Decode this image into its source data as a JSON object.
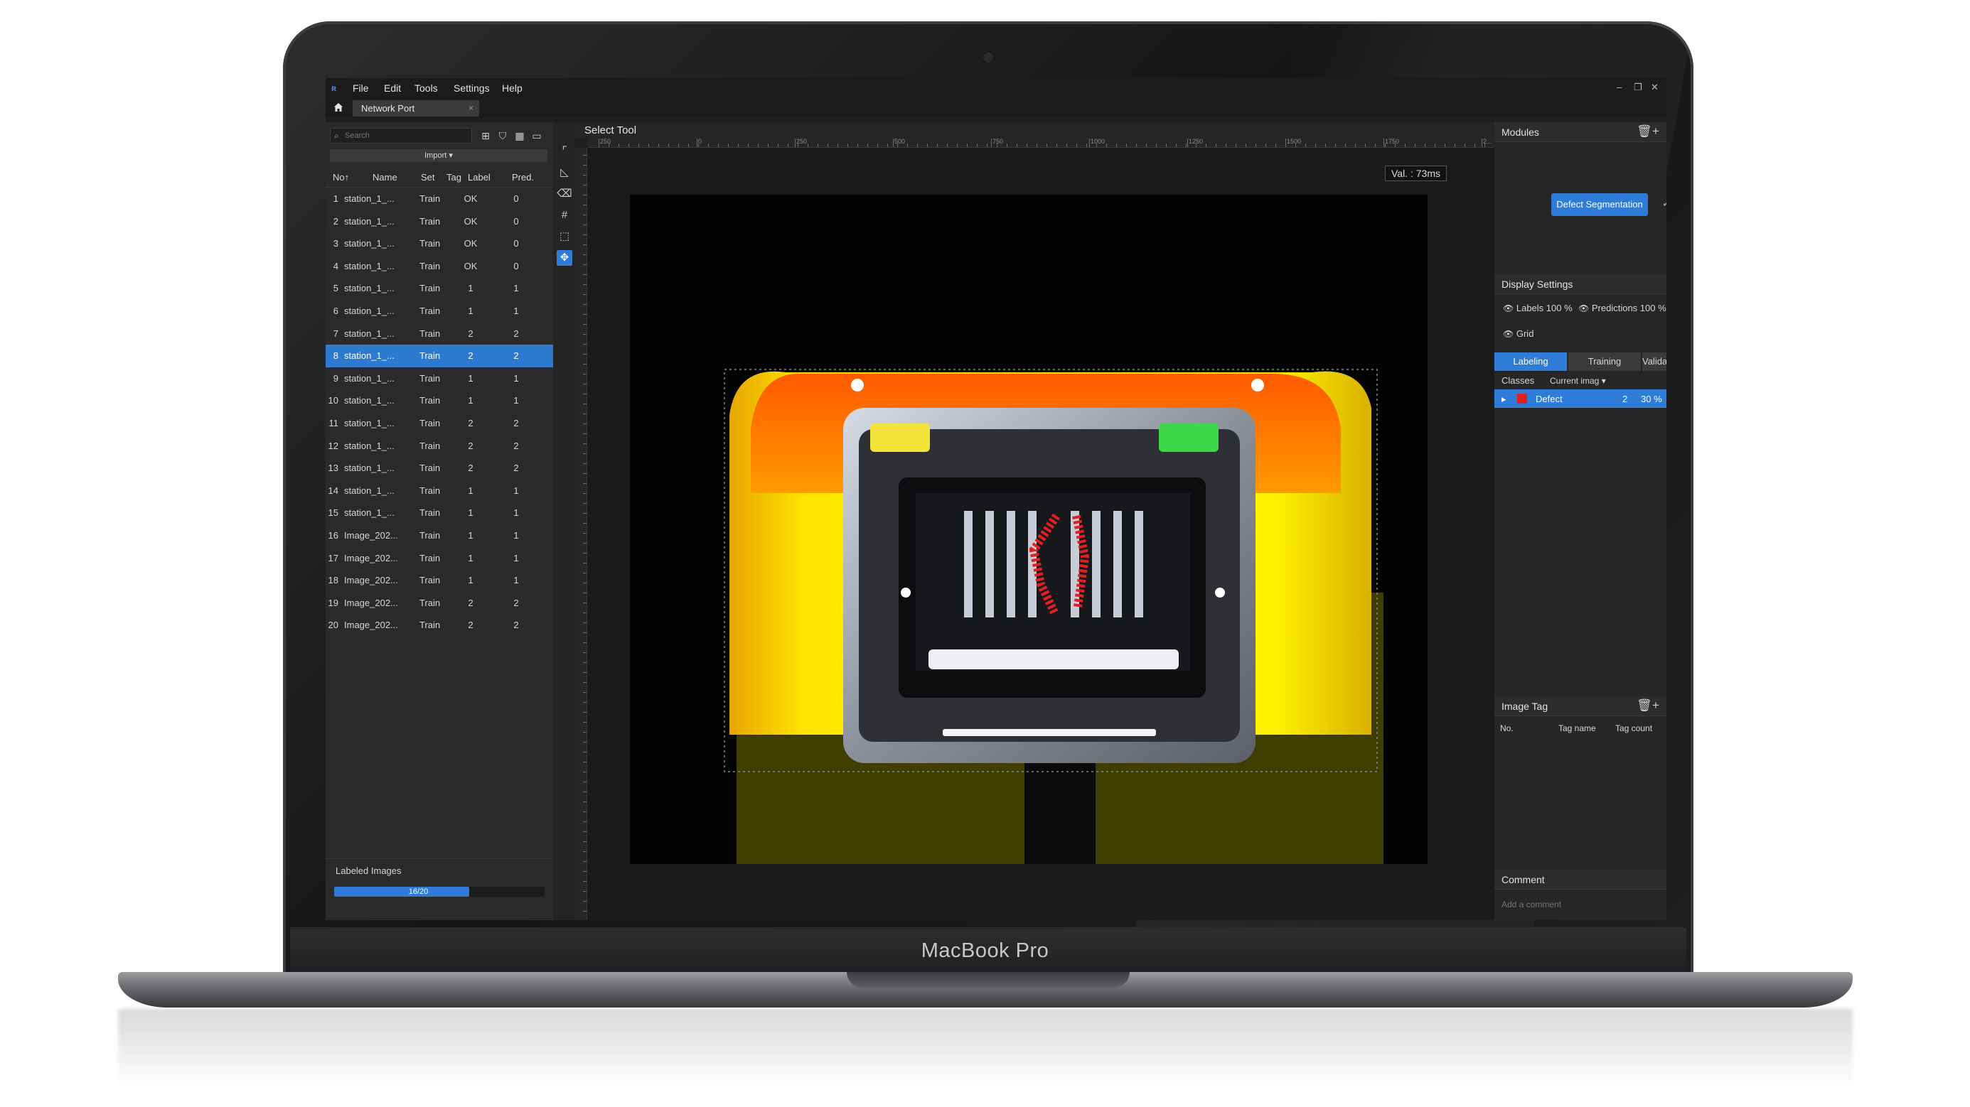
{
  "device": {
    "brand_label": "MacBook Pro"
  },
  "app": {
    "menu": [
      "File",
      "Edit",
      "Tools",
      "Settings",
      "Help"
    ],
    "window_controls": [
      "–",
      "❐",
      "✕"
    ],
    "project_tab": {
      "label": "Network Port",
      "close": "×"
    }
  },
  "left_panel": {
    "search": {
      "placeholder": "Search"
    },
    "import_label": "Import ▾",
    "columns": {
      "no": "No↑",
      "name": "Name",
      "set": "Set",
      "tag": "Tag",
      "label": "Label",
      "pred": "Pred."
    },
    "rows": [
      {
        "no": "1",
        "name": "station_1_...",
        "set": "Train",
        "label": "OK",
        "pred": "0"
      },
      {
        "no": "2",
        "name": "station_1_...",
        "set": "Train",
        "label": "OK",
        "pred": "0"
      },
      {
        "no": "3",
        "name": "station_1_...",
        "set": "Train",
        "label": "OK",
        "pred": "0"
      },
      {
        "no": "4",
        "name": "station_1_...",
        "set": "Train",
        "label": "OK",
        "pred": "0"
      },
      {
        "no": "5",
        "name": "station_1_...",
        "set": "Train",
        "label": "1",
        "pred": "1"
      },
      {
        "no": "6",
        "name": "station_1_...",
        "set": "Train",
        "label": "1",
        "pred": "1"
      },
      {
        "no": "7",
        "name": "station_1_...",
        "set": "Train",
        "label": "2",
        "pred": "2"
      },
      {
        "no": "8",
        "name": "station_1_...",
        "set": "Train",
        "label": "2",
        "pred": "2",
        "selected": true
      },
      {
        "no": "9",
        "name": "station_1_...",
        "set": "Train",
        "label": "1",
        "pred": "1"
      },
      {
        "no": "10",
        "name": "station_1_...",
        "set": "Train",
        "label": "1",
        "pred": "1"
      },
      {
        "no": "11",
        "name": "station_1_...",
        "set": "Train",
        "label": "2",
        "pred": "2"
      },
      {
        "no": "12",
        "name": "station_1_...",
        "set": "Train",
        "label": "2",
        "pred": "2"
      },
      {
        "no": "13",
        "name": "station_1_...",
        "set": "Train",
        "label": "2",
        "pred": "2"
      },
      {
        "no": "14",
        "name": "station_1_...",
        "set": "Train",
        "label": "1",
        "pred": "1"
      },
      {
        "no": "15",
        "name": "station_1_...",
        "set": "Train",
        "label": "1",
        "pred": "1"
      },
      {
        "no": "16",
        "name": "Image_202...",
        "set": "Train",
        "label": "1",
        "pred": "1"
      },
      {
        "no": "17",
        "name": "Image_202...",
        "set": "Train",
        "label": "1",
        "pred": "1"
      },
      {
        "no": "18",
        "name": "Image_202...",
        "set": "Train",
        "label": "1",
        "pred": "1"
      },
      {
        "no": "19",
        "name": "Image_202...",
        "set": "Train",
        "label": "2",
        "pred": "2"
      },
      {
        "no": "20",
        "name": "Image_202...",
        "set": "Train",
        "label": "2",
        "pred": "2"
      }
    ],
    "labeled_images": {
      "title": "Labeled Images",
      "progress_text": "16/20",
      "progress_fraction": 0.8
    }
  },
  "canvas": {
    "title": "Select Tool",
    "val_badge": "Val. : 73ms",
    "ruler_labels": [
      "250",
      "0",
      "250",
      "500",
      "750",
      "1000",
      "1250",
      "1500",
      "1750",
      "2..."
    ]
  },
  "right_panel": {
    "modules": {
      "title": "Modules",
      "node_label": "Defect Segmentation",
      "check": "✓"
    },
    "display_settings": {
      "title": "Display Settings",
      "labels": "Labels",
      "labels_pct": "100 %",
      "predictions": "Predictions",
      "predictions_pct": "100 %",
      "grid": "Grid"
    },
    "tabs": [
      "Labeling",
      "Training",
      "Validation"
    ],
    "classes": {
      "label": "Classes",
      "select_value": "Current imag ▾",
      "items": [
        {
          "name": "Defect",
          "count": "2",
          "pct": "30 %",
          "color": "#e02020"
        }
      ]
    },
    "image_tag": {
      "title": "Image Tag",
      "col_no": "No.",
      "col_name": "Tag name",
      "col_count": "Tag count"
    },
    "comment": {
      "title": "Comment",
      "placeholder": "Add a comment"
    }
  },
  "colors": {
    "accent": "#2f7bd8",
    "panel_bg": "#2a2a2b",
    "defect": "#e02020"
  }
}
